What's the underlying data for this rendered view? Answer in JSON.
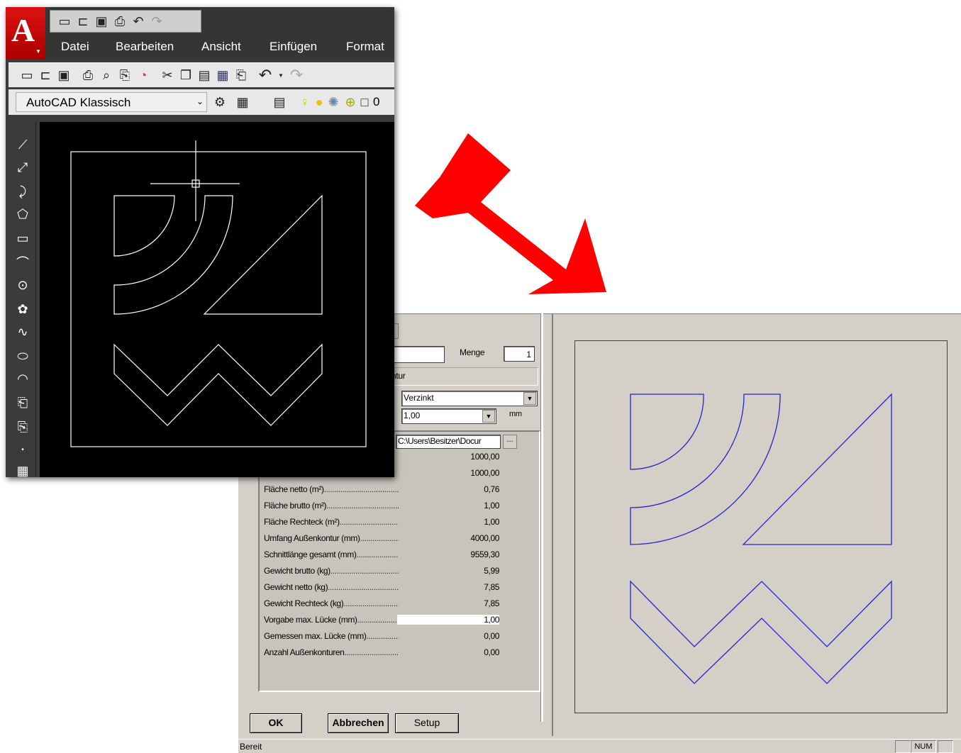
{
  "acad": {
    "menu": [
      "Datei",
      "Bearbeiten",
      "Ansicht",
      "Einfügen",
      "Format"
    ],
    "workspace": "AutoCAD Klassisch",
    "layer_value": "0"
  },
  "dialog": {
    "title_partial": "",
    "menge_label": "Menge",
    "menge_value": "1",
    "kontur_partial": "ntur",
    "material": "Verzinkt",
    "thickness": "1,00",
    "unit": "mm",
    "path": "C:\\Users\\Besitzer\\Docur",
    "browse": "...",
    "top_values": [
      "1000,00",
      "1000,00"
    ],
    "props": [
      {
        "label": "Fläche netto (m²)",
        "value": "0,76"
      },
      {
        "label": "Fläche brutto (m²)",
        "value": "1,00"
      },
      {
        "label": "Fläche Rechteck (m²)",
        "value": "1,00"
      },
      {
        "label": "Umfang Außenkontur (mm)",
        "value": "4000,00"
      },
      {
        "label": "Schnittlänge gesamt (mm)",
        "value": "9559,30"
      },
      {
        "label": "Gewicht brutto (kg)",
        "value": "5,99"
      },
      {
        "label": "Gewicht netto (kg)",
        "value": "7,85"
      },
      {
        "label": "Gewicht Rechteck (kg)",
        "value": "7,85"
      },
      {
        "label": "Vorgabe max. Lücke (mm)",
        "value": "1,00"
      },
      {
        "label": "Gemessen max. Lücke (mm)",
        "value": "0,00"
      },
      {
        "label": "Anzahl Außenkonturen",
        "value": "0,00"
      }
    ],
    "buttons": {
      "ok": "OK",
      "cancel": "Abbrechen",
      "setup": "Setup"
    },
    "status": "Bereit",
    "status_num": "NUM"
  },
  "colors": {
    "arrow": "#ff0000",
    "preview_stroke": "#2323d8",
    "cad_bg": "#000000",
    "dialog_bg": "#d4d0c8"
  }
}
